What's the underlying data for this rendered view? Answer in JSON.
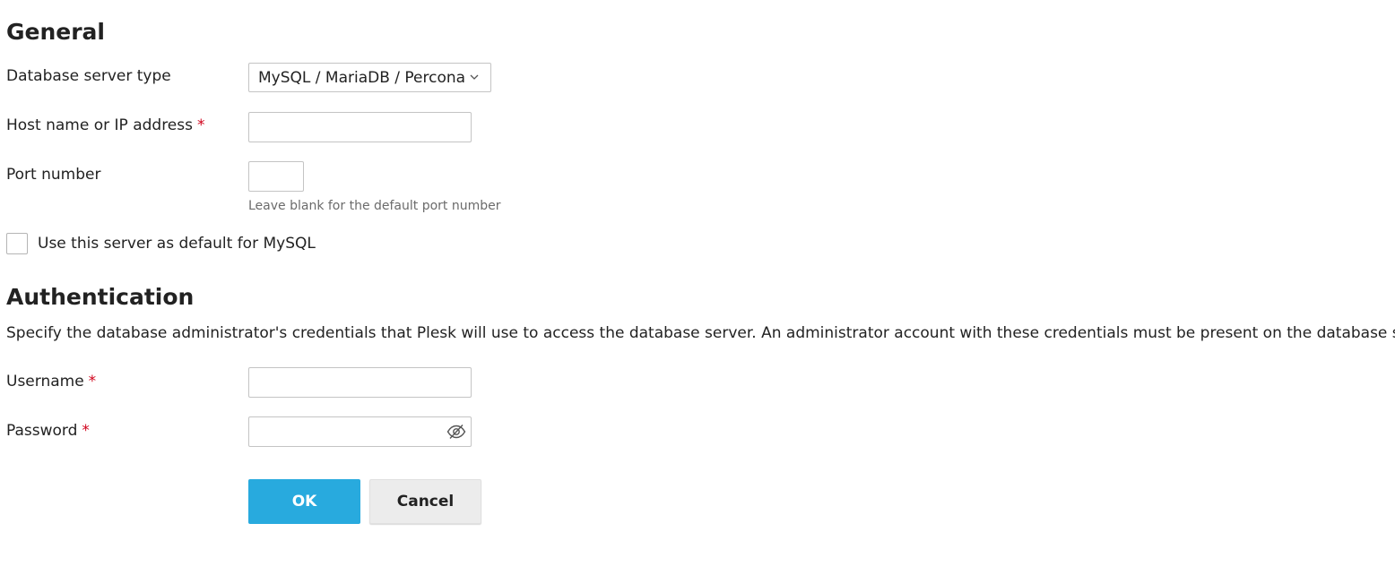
{
  "general": {
    "title": "General",
    "server_type": {
      "label": "Database server type",
      "selected": "MySQL / MariaDB / Percona"
    },
    "host": {
      "label": "Host name or IP address",
      "required_mark": "*",
      "value": ""
    },
    "port": {
      "label": "Port number",
      "value": "",
      "hint": "Leave blank for the default port number"
    },
    "default_checkbox": {
      "label": "Use this server as default for MySQL",
      "checked": false
    }
  },
  "authentication": {
    "title": "Authentication",
    "description": "Specify the database administrator's credentials that Plesk will use to access the database server. An administrator account with these credentials must be present on the database server.",
    "username": {
      "label": "Username",
      "required_mark": "*",
      "value": ""
    },
    "password": {
      "label": "Password",
      "required_mark": "*",
      "value": "",
      "toggle_icon": "eye-slash-icon"
    }
  },
  "actions": {
    "ok_label": "OK",
    "cancel_label": "Cancel"
  },
  "colors": {
    "primary": "#28aade",
    "required": "#d0021b",
    "hint": "#6b6b6b"
  }
}
